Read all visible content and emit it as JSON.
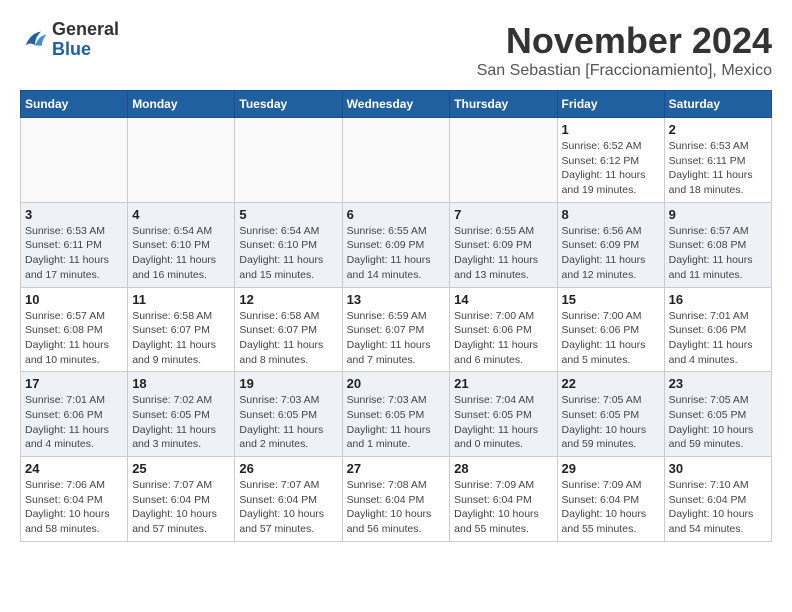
{
  "header": {
    "logo_general": "General",
    "logo_blue": "Blue",
    "month_title": "November 2024",
    "location": "San Sebastian [Fraccionamiento], Mexico"
  },
  "weekdays": [
    "Sunday",
    "Monday",
    "Tuesday",
    "Wednesday",
    "Thursday",
    "Friday",
    "Saturday"
  ],
  "weeks": [
    [
      {
        "day": "",
        "info": ""
      },
      {
        "day": "",
        "info": ""
      },
      {
        "day": "",
        "info": ""
      },
      {
        "day": "",
        "info": ""
      },
      {
        "day": "",
        "info": ""
      },
      {
        "day": "1",
        "info": "Sunrise: 6:52 AM\nSunset: 6:12 PM\nDaylight: 11 hours and 19 minutes."
      },
      {
        "day": "2",
        "info": "Sunrise: 6:53 AM\nSunset: 6:11 PM\nDaylight: 11 hours and 18 minutes."
      }
    ],
    [
      {
        "day": "3",
        "info": "Sunrise: 6:53 AM\nSunset: 6:11 PM\nDaylight: 11 hours and 17 minutes."
      },
      {
        "day": "4",
        "info": "Sunrise: 6:54 AM\nSunset: 6:10 PM\nDaylight: 11 hours and 16 minutes."
      },
      {
        "day": "5",
        "info": "Sunrise: 6:54 AM\nSunset: 6:10 PM\nDaylight: 11 hours and 15 minutes."
      },
      {
        "day": "6",
        "info": "Sunrise: 6:55 AM\nSunset: 6:09 PM\nDaylight: 11 hours and 14 minutes."
      },
      {
        "day": "7",
        "info": "Sunrise: 6:55 AM\nSunset: 6:09 PM\nDaylight: 11 hours and 13 minutes."
      },
      {
        "day": "8",
        "info": "Sunrise: 6:56 AM\nSunset: 6:09 PM\nDaylight: 11 hours and 12 minutes."
      },
      {
        "day": "9",
        "info": "Sunrise: 6:57 AM\nSunset: 6:08 PM\nDaylight: 11 hours and 11 minutes."
      }
    ],
    [
      {
        "day": "10",
        "info": "Sunrise: 6:57 AM\nSunset: 6:08 PM\nDaylight: 11 hours and 10 minutes."
      },
      {
        "day": "11",
        "info": "Sunrise: 6:58 AM\nSunset: 6:07 PM\nDaylight: 11 hours and 9 minutes."
      },
      {
        "day": "12",
        "info": "Sunrise: 6:58 AM\nSunset: 6:07 PM\nDaylight: 11 hours and 8 minutes."
      },
      {
        "day": "13",
        "info": "Sunrise: 6:59 AM\nSunset: 6:07 PM\nDaylight: 11 hours and 7 minutes."
      },
      {
        "day": "14",
        "info": "Sunrise: 7:00 AM\nSunset: 6:06 PM\nDaylight: 11 hours and 6 minutes."
      },
      {
        "day": "15",
        "info": "Sunrise: 7:00 AM\nSunset: 6:06 PM\nDaylight: 11 hours and 5 minutes."
      },
      {
        "day": "16",
        "info": "Sunrise: 7:01 AM\nSunset: 6:06 PM\nDaylight: 11 hours and 4 minutes."
      }
    ],
    [
      {
        "day": "17",
        "info": "Sunrise: 7:01 AM\nSunset: 6:06 PM\nDaylight: 11 hours and 4 minutes."
      },
      {
        "day": "18",
        "info": "Sunrise: 7:02 AM\nSunset: 6:05 PM\nDaylight: 11 hours and 3 minutes."
      },
      {
        "day": "19",
        "info": "Sunrise: 7:03 AM\nSunset: 6:05 PM\nDaylight: 11 hours and 2 minutes."
      },
      {
        "day": "20",
        "info": "Sunrise: 7:03 AM\nSunset: 6:05 PM\nDaylight: 11 hours and 1 minute."
      },
      {
        "day": "21",
        "info": "Sunrise: 7:04 AM\nSunset: 6:05 PM\nDaylight: 11 hours and 0 minutes."
      },
      {
        "day": "22",
        "info": "Sunrise: 7:05 AM\nSunset: 6:05 PM\nDaylight: 10 hours and 59 minutes."
      },
      {
        "day": "23",
        "info": "Sunrise: 7:05 AM\nSunset: 6:05 PM\nDaylight: 10 hours and 59 minutes."
      }
    ],
    [
      {
        "day": "24",
        "info": "Sunrise: 7:06 AM\nSunset: 6:04 PM\nDaylight: 10 hours and 58 minutes."
      },
      {
        "day": "25",
        "info": "Sunrise: 7:07 AM\nSunset: 6:04 PM\nDaylight: 10 hours and 57 minutes."
      },
      {
        "day": "26",
        "info": "Sunrise: 7:07 AM\nSunset: 6:04 PM\nDaylight: 10 hours and 57 minutes."
      },
      {
        "day": "27",
        "info": "Sunrise: 7:08 AM\nSunset: 6:04 PM\nDaylight: 10 hours and 56 minutes."
      },
      {
        "day": "28",
        "info": "Sunrise: 7:09 AM\nSunset: 6:04 PM\nDaylight: 10 hours and 55 minutes."
      },
      {
        "day": "29",
        "info": "Sunrise: 7:09 AM\nSunset: 6:04 PM\nDaylight: 10 hours and 55 minutes."
      },
      {
        "day": "30",
        "info": "Sunrise: 7:10 AM\nSunset: 6:04 PM\nDaylight: 10 hours and 54 minutes."
      }
    ]
  ]
}
